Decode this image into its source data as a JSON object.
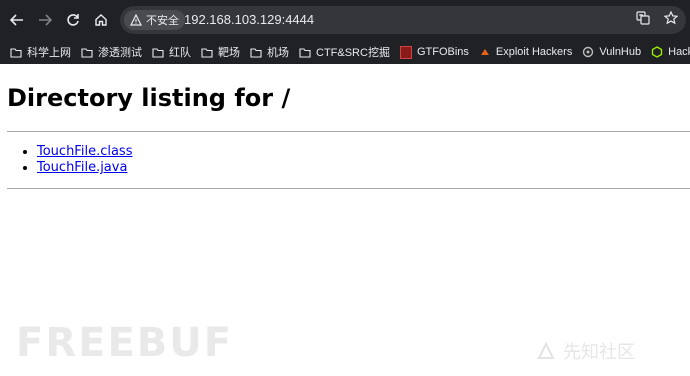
{
  "browser": {
    "security_label": "不安全",
    "url": "192.168.103.129:4444",
    "bookmarks": [
      {
        "label": "科学上网",
        "icon": "folder-icon"
      },
      {
        "label": "渗透测试",
        "icon": "folder-icon"
      },
      {
        "label": "红队",
        "icon": "folder-icon"
      },
      {
        "label": "靶场",
        "icon": "folder-icon"
      },
      {
        "label": "机场",
        "icon": "folder-icon"
      },
      {
        "label": "CTF&SRC挖掘",
        "icon": "folder-icon"
      },
      {
        "label": "GTFOBins",
        "icon": "gtfobins-icon"
      },
      {
        "label": "Exploit Hackers",
        "icon": "exploit-icon"
      },
      {
        "label": "VulnHub",
        "icon": "vulnhub-icon"
      },
      {
        "label": "Hack Th",
        "icon": "hack-the-box-icon"
      }
    ]
  },
  "page": {
    "title": "Directory listing for /",
    "files": [
      "TouchFile.class",
      "TouchFile.java"
    ]
  },
  "watermarks": {
    "left": "FREEBUF",
    "right": "先知社区"
  }
}
